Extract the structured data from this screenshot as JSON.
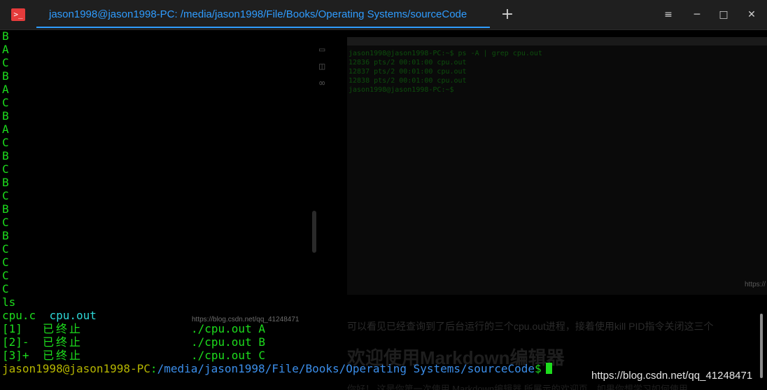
{
  "window": {
    "title": "jason1998@jason1998-PC: /media/jason1998/File/Books/Operating Systems/sourceCode",
    "icon": "terminal-icon",
    "add_tab": "+",
    "minimize": "─",
    "maximize": "□",
    "close": "✕",
    "menu": "≡",
    "accent_color": "#2f9cff"
  },
  "terminal": {
    "letters": [
      "B",
      "A",
      "C",
      "B",
      "A",
      "C",
      "B",
      "A",
      "C",
      "B",
      "C",
      "B",
      "C",
      "B",
      "C",
      "B",
      "C",
      "C",
      "C",
      "C"
    ],
    "ls_cmd": "ls",
    "ls_out_1": "cpu.c",
    "ls_out_2": "cpu.out",
    "jobs": [
      {
        "id": "[1]",
        "state": "已终止",
        "cmd": "./cpu.out A"
      },
      {
        "id": "[2]-",
        "state": "已终止",
        "cmd": "./cpu.out B"
      },
      {
        "id": "[3]+",
        "state": "已终止",
        "cmd": "./cpu.out C"
      }
    ],
    "prompt_user": "jason1998@jason1998-PC",
    "prompt_sep": ":",
    "prompt_path": "/media/jason1998/File/Books/Operating Systems/sourceCode",
    "prompt_end": "$"
  },
  "background_page": {
    "image_watermark": "https://blog.csdn.net/qq_41248471",
    "right_terminal_lines": [
      "jason1998@jason1998-PC:~$ ps -A | grep cpu.out",
      "12836 pts/2    00:01:00 cpu.out",
      "12837 pts/2    00:01:00 cpu.out",
      "12838 pts/2    00:01:00 cpu.out",
      "jason1998@jason1998-PC:~$"
    ],
    "right_watermark": "https://",
    "sentence": "可以看见已经查询到了后台运行的三个cpu.out进程，接着使用kill PID指令关闭这三个",
    "heading": "欢迎使用Markdown编辑器",
    "small_text": "你好！ 这是你第一次使用 Markdown编辑器 所展示的欢迎页。如果你想学习如何使用"
  },
  "watermark": "https://blog.csdn.net/qq_41248471"
}
